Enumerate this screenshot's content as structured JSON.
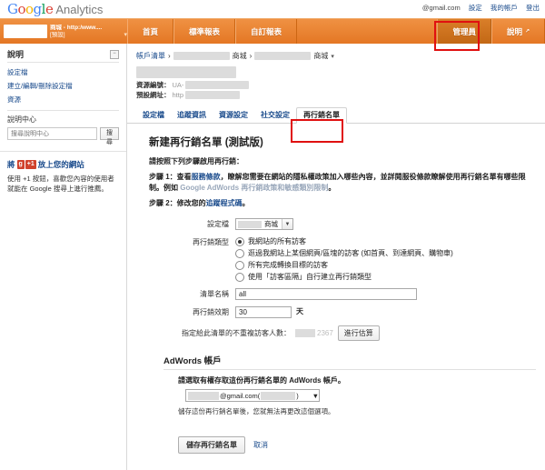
{
  "header": {
    "logo_google": "Google",
    "logo_product": "Analytics",
    "account_email": "@gmail.com",
    "links": [
      "設定",
      "我的帳戶",
      "登出"
    ]
  },
  "orange_bar": {
    "profile_name": "商城 - http:/www....",
    "profile_sub": "[預設]",
    "tabs": [
      {
        "label": "首頁",
        "active": false
      },
      {
        "label": "標準報表",
        "active": false
      },
      {
        "label": "自訂報表",
        "active": false
      }
    ],
    "right_tabs": [
      {
        "label": "管理員",
        "active": true
      },
      {
        "label": "說明",
        "active": false,
        "external": "↗"
      }
    ]
  },
  "sidebar": {
    "title": "說明",
    "collapse_glyph": "−",
    "links": [
      "設定檔",
      "建立/編輯/刪除設定檔",
      "資源"
    ],
    "help_center_title": "說明中心",
    "search_placeholder": "搜尋說明中心",
    "search_button": "搜尋",
    "promo": {
      "prefix": "將",
      "badge_g": "g",
      "badge_plus1": "+1",
      "suffix": "放上您的網站",
      "body": "使用 +1 按鈕，喜歡您內容的使用者就能在 Google 搜尋上進行推薦。"
    }
  },
  "main": {
    "breadcrumb": {
      "root": "帳戶清單",
      "sep": "›",
      "item1_suffix": "商城",
      "item2_suffix": "商城",
      "caret": "▾"
    },
    "property": {
      "id_label": "資源編號：",
      "id_value": "UA-",
      "url_label": "預設網址：",
      "url_value": "http"
    },
    "subtabs": [
      {
        "label": "設定檔",
        "active": false
      },
      {
        "label": "追蹤資訊",
        "active": false
      },
      {
        "label": "資源設定",
        "active": false
      },
      {
        "label": "社交設定",
        "active": false
      },
      {
        "label": "再行銷名單",
        "active": true
      }
    ],
    "page_title": "新建再行銷名單 (測試版)",
    "lead": "請按照下列步驟啟用再行銷：",
    "step1": {
      "prefix": "步驟 1：查看",
      "link1": "服務條款",
      "mid": "，瞭解您需要在網站的隱私權政策加入哪些內容，並詳閱服役條款瞭解使用再行銷名單有哪些限制。例如",
      "light_link": "Google AdWords 再行銷政策和敏感類別限制",
      "suffix": "。"
    },
    "step2": {
      "prefix": "步驟 2：修改您的",
      "link": "追蹤程式碼",
      "suffix": "。"
    },
    "form": {
      "profile_label": "設定檔",
      "profile_value": "商城",
      "type_label": "再行銷類型",
      "type_options": [
        {
          "label": "我網站的所有訪客",
          "checked": true
        },
        {
          "label": "逛過我網站上某個網頁/區塊的訪客 (如首頁、到達網頁、購物車)",
          "checked": false
        },
        {
          "label": "所有完成轉換目標的訪客",
          "checked": false
        },
        {
          "label": "使用「訪客區隔」自行建立再行銷類型",
          "checked": false
        }
      ],
      "list_name_label": "清單名稱",
      "list_name_value": "all",
      "duration_label": "再行銷效期",
      "duration_value": "30",
      "duration_unit": "天",
      "estimate_label": "指定給此清單的不重複訪客人數：",
      "estimate_value": "2367",
      "estimate_button": "進行估算"
    },
    "adwords": {
      "section_title": "AdWords 帳戶",
      "select_label": "請選取有權存取這份再行銷名單的 AdWords 帳戶。",
      "select_email": "@gmail.com(",
      "select_close": ")",
      "note": "儲存這份再行銷名單後，您就無法再更改這個選項。"
    },
    "actions": {
      "save_label": "儲存再行銷名單",
      "cancel_label": "取消"
    }
  },
  "colors": {
    "orange": "#e8812b",
    "link_blue": "#1a4b8c",
    "annotation_red": "#e01010"
  }
}
